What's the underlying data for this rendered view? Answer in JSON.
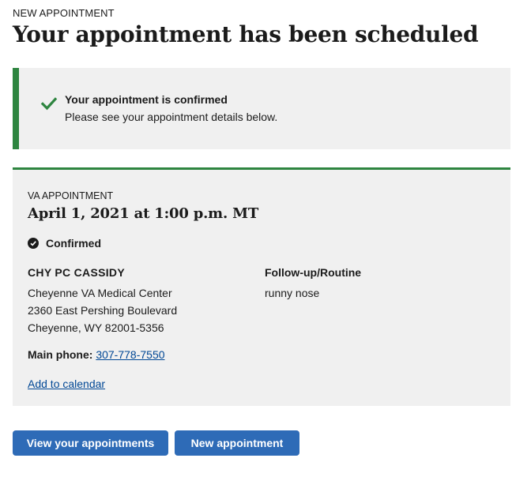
{
  "header": {
    "eyebrow": "NEW APPOINTMENT",
    "title": "Your appointment has been scheduled"
  },
  "alert": {
    "icon": "check-icon",
    "heading": "Your appointment is confirmed",
    "body": "Please see your appointment details below.",
    "accent_color": "#2e8540"
  },
  "appointment": {
    "type_label": "VA APPOINTMENT",
    "datetime": "April 1, 2021 at 1:00 p.m. MT",
    "status_icon": "check-circle-icon",
    "status": "Confirmed",
    "clinic": "CHY PC CASSIDY",
    "facility": "Cheyenne VA Medical Center",
    "street": "2360 East Pershing Boulevard",
    "city_state_zip": "Cheyenne, WY 82001-5356",
    "phone_label": "Main phone:",
    "phone": "307-778-7550",
    "calendar_link": "Add to calendar",
    "reason_type": "Follow-up/Routine",
    "reason_text": "runny nose"
  },
  "actions": {
    "view_label": "View your appointments",
    "new_label": "New appointment",
    "button_color": "#2e6bb7"
  }
}
